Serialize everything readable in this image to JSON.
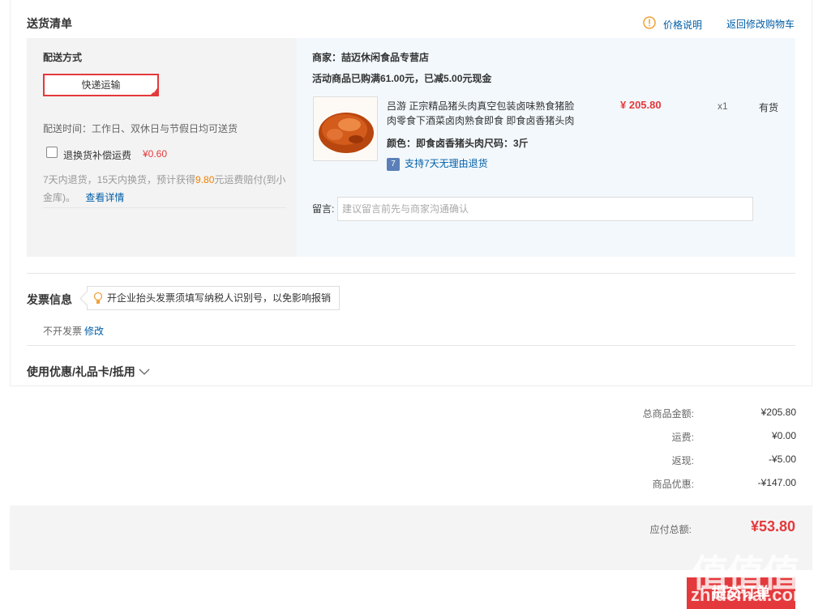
{
  "delivery": {
    "title": "送货清单",
    "price_note": "价格说明",
    "back_to_cart": "返回修改购物车",
    "method_title": "配送方式",
    "method_button": "快递运输",
    "delivery_time": "配送时间：工作日、双休日与节假日均可送货",
    "insurance_label": "退换货补偿运费",
    "insurance_price": "¥0.60",
    "insurance_desc_1": "7天内退货，15天内换货，预计获得",
    "insurance_amount": "9.80",
    "insurance_desc_2": "元运费赔付(到小",
    "insurance_desc_3": "金库)。",
    "details_link": "查看详情"
  },
  "shop": {
    "merchant": "商家：喆迈休闲食品专营店",
    "promotion": "活动商品已购满61.00元，已减5.00元现金",
    "product_title_1": "吕游 正宗精品猪头肉真空包装卤味熟食猪脸",
    "product_title_2": "肉零食下酒菜卤肉熟食即食 即食卤香猪头肉",
    "product_spec": "颜色：即食卤香猪头肉尺码：3斤",
    "product_price": "¥ 205.80",
    "product_qty": "x1",
    "product_stock": "有货",
    "seven_badge": "7",
    "return_policy": "支持7天无理由退货",
    "message_label": "留言:",
    "message_placeholder": "建议留言前先与商家沟通确认"
  },
  "invoice": {
    "title": "发票信息",
    "tip": "开企业抬头发票须填写纳税人识别号，以免影响报销",
    "status": "不开发票",
    "modify": "修改"
  },
  "coupon": {
    "title": "使用优惠/礼品卡/抵用"
  },
  "summary": {
    "rows": [
      {
        "label": "总商品金额:",
        "value": "¥205.80"
      },
      {
        "label": "运费:",
        "value": "¥0.00"
      },
      {
        "label": "返现:",
        "value": "-¥5.00"
      },
      {
        "label": "商品优惠:",
        "value": "-¥147.00"
      }
    ],
    "total_label": "应付总额:",
    "total_value": "¥53.80",
    "submit": "提交订单"
  },
  "watermark": {
    "logo": "值值值",
    "site": "zhidemai.com"
  },
  "colors": {
    "accent": "#e4393c",
    "link": "#005ea7",
    "panel": "#f3f3f3",
    "shop_panel": "#f3f8fc"
  },
  "icons": [
    "warning-icon",
    "checkbox-icon",
    "lightbulb-icon",
    "chevron-down-icon",
    "checkmark-icon"
  ]
}
